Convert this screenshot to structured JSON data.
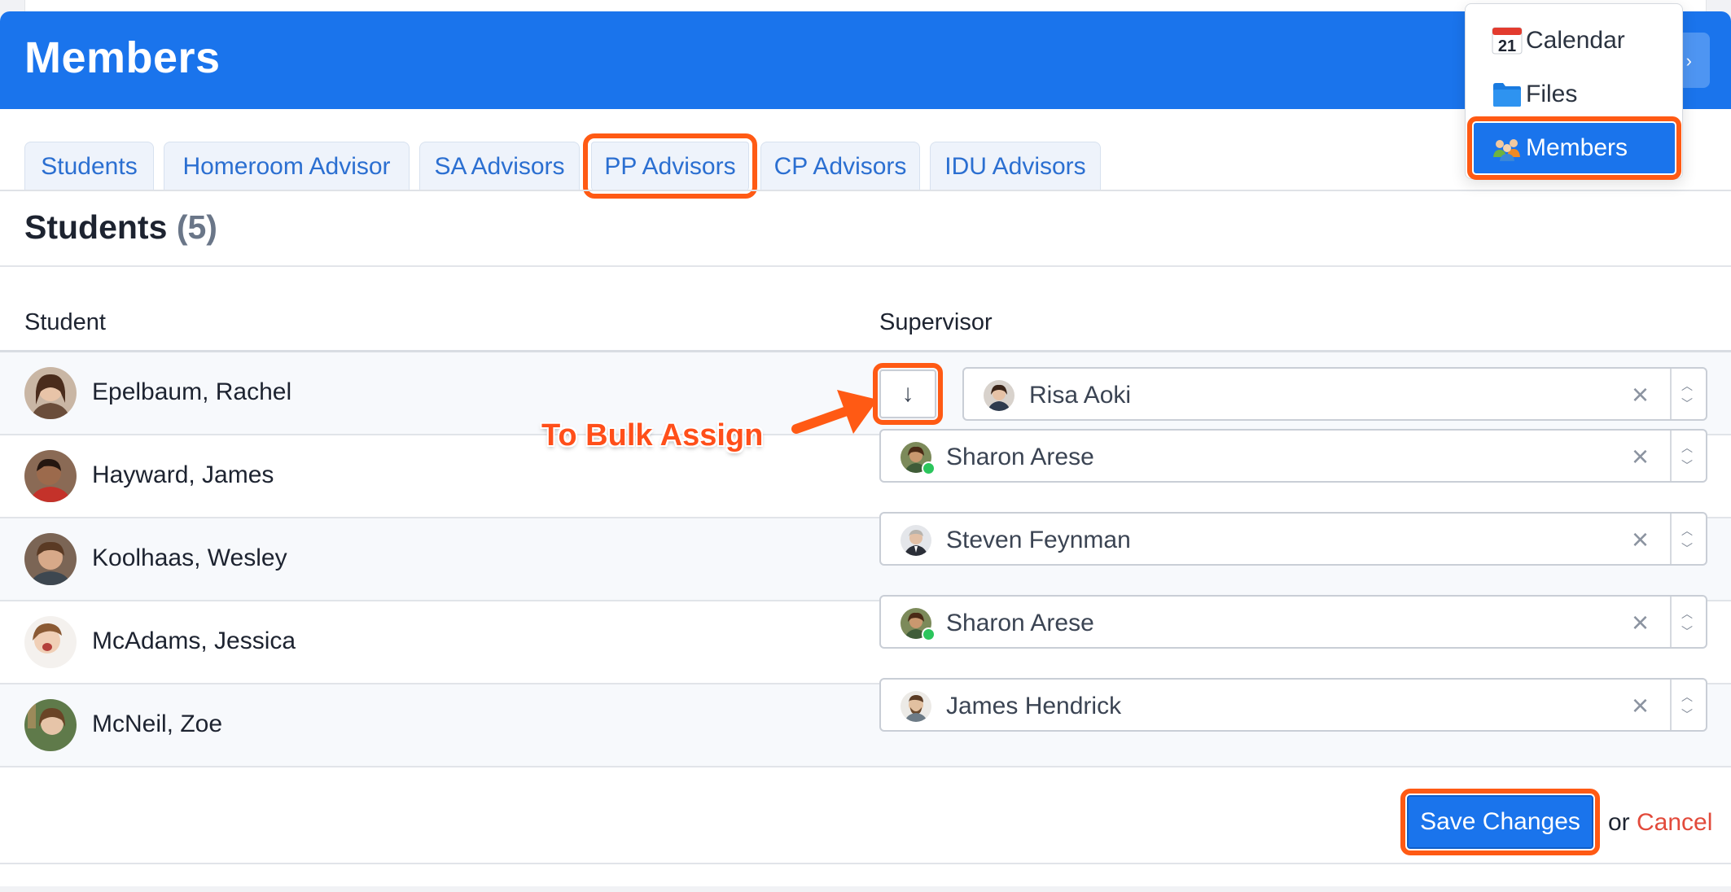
{
  "header": {
    "title": "Members"
  },
  "tabs": [
    {
      "label": "Students",
      "highlighted": false
    },
    {
      "label": "Homeroom Advisor",
      "highlighted": false
    },
    {
      "label": "SA Advisors",
      "highlighted": false
    },
    {
      "label": "PP Advisors",
      "highlighted": true
    },
    {
      "label": "CP Advisors",
      "highlighted": false
    },
    {
      "label": "IDU Advisors",
      "highlighted": false
    }
  ],
  "section": {
    "title": "Students",
    "count": "(5)"
  },
  "table": {
    "headers": {
      "student": "Student",
      "supervisor": "Supervisor"
    },
    "rows": [
      {
        "student": "Epelbaum, Rachel",
        "supervisor": "Risa Aoki",
        "online": false
      },
      {
        "student": "Hayward, James",
        "supervisor": "Sharon Arese",
        "online": true
      },
      {
        "student": "Koolhaas, Wesley",
        "supervisor": "Steven Feynman",
        "online": false
      },
      {
        "student": "McAdams, Jessica",
        "supervisor": "Sharon Arese",
        "online": true
      },
      {
        "student": "McNeil, Zoe",
        "supervisor": "James Hendrick",
        "online": false
      }
    ]
  },
  "bulk_assign": {
    "icon": "arrow-down-icon",
    "glyph": "↓"
  },
  "annotation": {
    "text": "To Bulk Assign",
    "color": "#ff5a14"
  },
  "actions": {
    "save_label": "Save Changes",
    "or_text": "or",
    "cancel_label": "Cancel"
  },
  "menu": {
    "items": [
      {
        "label": "Calendar",
        "icon": "calendar-icon",
        "active": false
      },
      {
        "label": "Files",
        "icon": "folder-icon",
        "active": false
      },
      {
        "label": "Members",
        "icon": "members-icon",
        "active": true
      }
    ]
  },
  "colors": {
    "primary": "#1a74ec",
    "highlight": "#ff5a14",
    "cancel": "#e24a3b",
    "online": "#2bc55c"
  }
}
